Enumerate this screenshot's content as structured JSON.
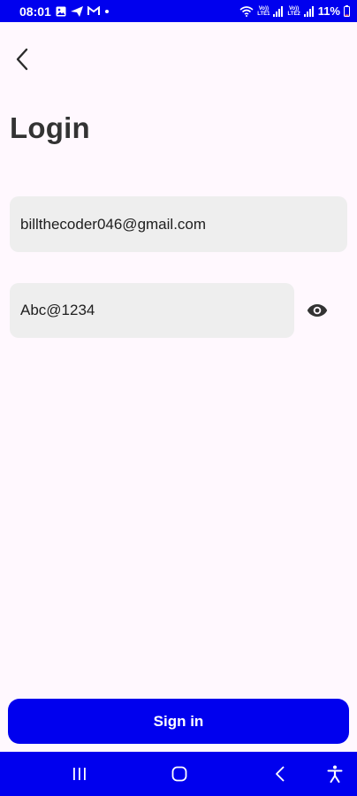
{
  "status_bar": {
    "time": "08:01",
    "battery": "11%",
    "sim1": "LTE1",
    "sim2": "LTE2",
    "volte": "Vo))",
    "colors": {
      "background": "#0000EE",
      "text": "#FFFFFF"
    },
    "icons": [
      "gallery-icon",
      "send-icon",
      "gmail-icon",
      "dot-icon",
      "wifi-icon",
      "signal-icon",
      "battery-icon"
    ]
  },
  "header": {
    "back_icon": "chevron-left-icon",
    "title": "Login"
  },
  "form": {
    "email_value": "billthecoder046@gmail.com",
    "password_value": "Abc@1234",
    "visibility_icon": "eye-icon"
  },
  "actions": {
    "signin_label": "Sign in"
  },
  "nav_bar": {
    "items": [
      "recent-apps-icon",
      "home-icon",
      "back-icon",
      "accessibility-icon"
    ]
  },
  "colors": {
    "accent": "#0000EE",
    "background": "#FFF8FE",
    "field_background": "#EEEEEE"
  }
}
